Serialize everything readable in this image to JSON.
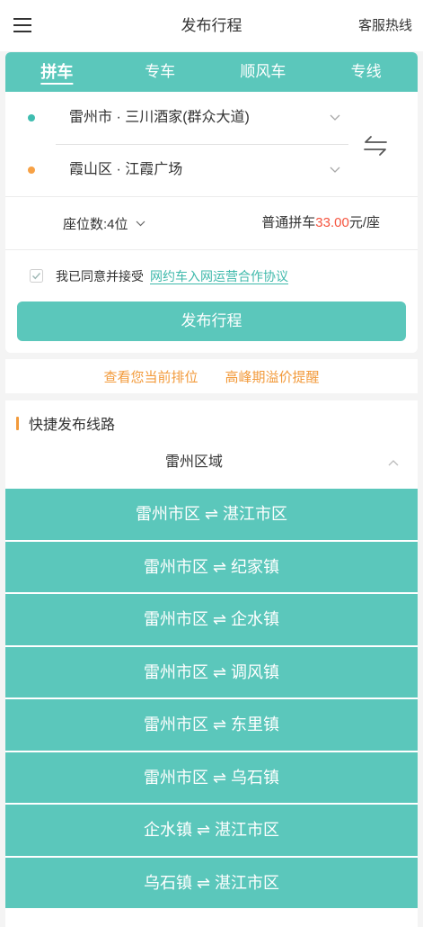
{
  "header": {
    "title": "发布行程",
    "service_hotline": "客服热线"
  },
  "tabs": [
    {
      "label": "拼车",
      "active": true
    },
    {
      "label": "专车",
      "active": false
    },
    {
      "label": "顺风车",
      "active": false
    },
    {
      "label": "专线",
      "active": false
    }
  ],
  "route": {
    "origin": "雷州市 · 三川酒家(群众大道)",
    "destination": "霞山区 · 江霞广场"
  },
  "seats": {
    "label": "座位数:4位"
  },
  "price": {
    "prefix": "普通拼车",
    "amount": "33.00",
    "unit": "元/座"
  },
  "agreement": {
    "checked": true,
    "text": "我已同意并接受",
    "link_text": "网约车入网运营合作协议"
  },
  "publish_button": {
    "label": "发布行程"
  },
  "notices": {
    "queue_position": "查看您当前排位",
    "peak_surcharge": "高峰期溢价提醒"
  },
  "quick_routes": {
    "title": "快捷发布线路",
    "region": "雷州区域",
    "expanded": true,
    "items": [
      "雷州市区 ⇌ 湛江市区",
      "雷州市区 ⇌ 纪家镇",
      "雷州市区 ⇌ 企水镇",
      "雷州市区 ⇌ 调风镇",
      "雷州市区 ⇌ 东里镇",
      "雷州市区 ⇌ 乌石镇",
      "企水镇 ⇌ 湛江市区",
      "乌石镇 ⇌ 湛江市区"
    ]
  },
  "colors": {
    "accent": "#5bc7bb",
    "link": "#3fb9ab",
    "notice_orange": "#f29a3b",
    "origin_dot": "#3fbdb0",
    "destination_dot": "#f7a145",
    "price_highlight": "#f5543f",
    "text": "#333333"
  },
  "icons": {
    "menu": "menu-icon",
    "dropdown": "chevron-down-icon",
    "swap": "swap-icon",
    "checkbox": "check-icon",
    "collapse": "chevron-up-icon"
  }
}
